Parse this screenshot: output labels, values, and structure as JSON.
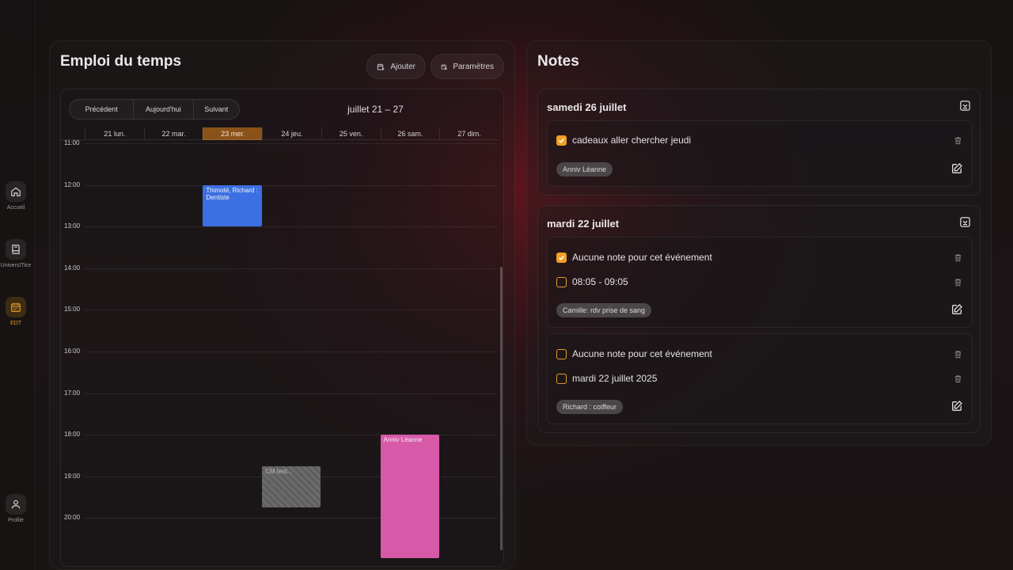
{
  "nav": {
    "items": [
      {
        "label": "Accueil",
        "icon": "home-icon"
      },
      {
        "label": "UniversITice",
        "icon": "book-icon"
      },
      {
        "label": "EDT",
        "icon": "calendar-icon",
        "active": true
      },
      {
        "label": "Profile",
        "icon": "user-icon"
      }
    ]
  },
  "schedule": {
    "title": "Emploi du temps",
    "add_label": "Ajouter",
    "settings_label": "Paramètres",
    "prev_label": "Précédent",
    "today_label": "Aujourd'hui",
    "next_label": "Suivant",
    "range_title": "juillet 21 – 27",
    "days": [
      "21 lun.",
      "22 mar.",
      "23 mer.",
      "24 jeu.",
      "25 ven.",
      "26 sam.",
      "27 dim."
    ],
    "today_index": 2,
    "hours": [
      "11:00",
      "12:00",
      "13:00",
      "14:00",
      "15:00",
      "16:00",
      "17:00",
      "18:00",
      "19:00",
      "20:00"
    ],
    "events": [
      {
        "title": "Thimoté, Richard : Dentiste",
        "day": "23 mer.",
        "start": "12:00",
        "end": "13:00",
        "style": "blue"
      },
      {
        "title": "CM test...",
        "day": "24 jeu.",
        "start": "18:45",
        "end": "19:45",
        "style": "hatched"
      },
      {
        "title": "Anniv Léanne",
        "day": "26 sam.",
        "start": "18:00",
        "end": "21:00",
        "style": "pink"
      }
    ]
  },
  "notes": {
    "title": "Notes",
    "groups": [
      {
        "date": "samedi 26 juillet",
        "cards": [
          {
            "items": [
              {
                "text": "cadeaux aller chercher jeudi",
                "checked": true
              }
            ],
            "tag": "Anniv Léanne"
          }
        ]
      },
      {
        "date": "mardi 22 juillet",
        "cards": [
          {
            "items": [
              {
                "text": "Aucune note pour cet événement",
                "checked": true
              },
              {
                "text": "08:05 - 09:05",
                "checked": false
              }
            ],
            "tag": "Camille: rdv prise de sang"
          },
          {
            "items": [
              {
                "text": "Aucune note pour cet événement",
                "checked": false
              },
              {
                "text": "mardi 22 juillet 2025",
                "checked": false
              }
            ],
            "tag": "Richard : coiffeur"
          }
        ]
      }
    ]
  },
  "colors": {
    "accent": "#f2a023",
    "today": "#8a5219",
    "event_blue": "#3c6fe2",
    "event_pink": "#d65aa8"
  }
}
